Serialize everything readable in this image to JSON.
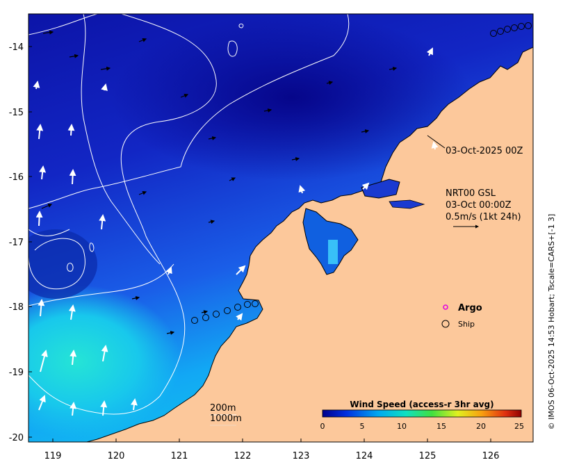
{
  "map": {
    "timestamp_label": "03-Oct-2025 00Z",
    "info_lines": [
      "NRT00 GSL",
      "03-Oct 00:00Z",
      "0.5m/s (1kt 24h)"
    ],
    "legend_argo": "Argo",
    "legend_ship": "Ship",
    "contour_200": "200m",
    "contour_1000": "1000m",
    "credit": "© IMOS 06-Oct-2025 14:53 Hobart; Tscale=CARS+[-1 3]",
    "colorbar": {
      "title": "Wind Speed (access-r 3hr avg)",
      "ticks": [
        "0",
        "5",
        "10",
        "15",
        "20",
        "25"
      ]
    },
    "x_ticks": [
      "119",
      "120",
      "121",
      "122",
      "123",
      "124",
      "125",
      "126"
    ],
    "y_ticks": [
      "-14",
      "-15",
      "-16",
      "-17",
      "-18",
      "-19",
      "-20"
    ],
    "colors": {
      "land": "#fcc89b",
      "ocean_deep": "#1414b4",
      "argo": "#e000e0"
    },
    "icons": [
      "north-arrow-icon",
      "argo-marker-icon",
      "ship-marker-icon"
    ]
  }
}
